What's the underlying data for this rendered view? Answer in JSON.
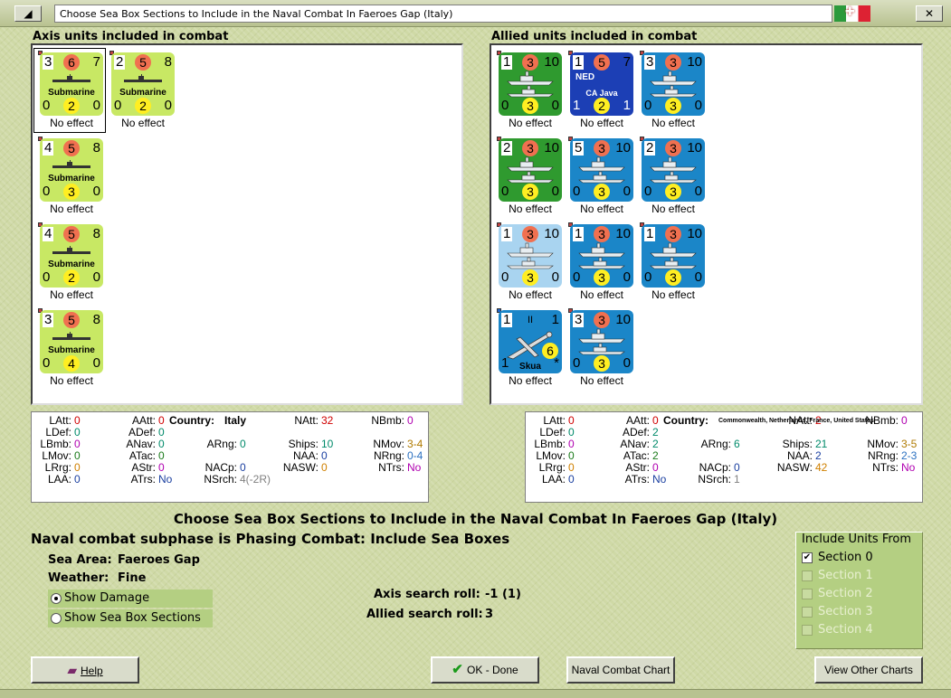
{
  "window": {
    "title": "Choose Sea Box Sections to Include in the Naval Combat In Faeroes Gap (Italy)",
    "close_glyph": "✕",
    "flag_glyph": "✚"
  },
  "axis": {
    "header": "Axis units included in combat",
    "units": [
      {
        "top": "3",
        "mid": "6",
        "right": "7",
        "name": "Submarine",
        "bl": "0",
        "bm": "2",
        "br": "0",
        "effect": "No effect"
      },
      {
        "top": "2",
        "mid": "5",
        "right": "8",
        "name": "Submarine",
        "bl": "0",
        "bm": "2",
        "br": "0",
        "effect": "No effect"
      },
      {
        "top": "4",
        "mid": "5",
        "right": "8",
        "name": "Submarine",
        "bl": "0",
        "bm": "3",
        "br": "0",
        "effect": "No effect"
      },
      {
        "top": "4",
        "mid": "5",
        "right": "8",
        "name": "Submarine",
        "bl": "0",
        "bm": "2",
        "br": "0",
        "effect": "No effect"
      },
      {
        "top": "3",
        "mid": "5",
        "right": "8",
        "name": "Submarine",
        "bl": "0",
        "bm": "4",
        "br": "0",
        "effect": "No effect"
      }
    ]
  },
  "allied": {
    "header": "Allied units included in combat",
    "units": [
      {
        "top": "1",
        "mid": "3",
        "right": "10",
        "name": "",
        "bl": "0",
        "bm": "3",
        "br": "0",
        "effect": "No effect",
        "color": "#2f9a2f"
      },
      {
        "top": "1",
        "mid": "5",
        "right": "7",
        "name": "CA Java",
        "extra": "NED",
        "bl": "1",
        "bm": "2",
        "br": "1",
        "effect": "No effect",
        "color": "#1c3fb5"
      },
      {
        "top": "3",
        "mid": "3",
        "right": "10",
        "name": "",
        "bl": "0",
        "bm": "3",
        "br": "0",
        "effect": "No effect",
        "color": "#1b86c8"
      },
      {
        "top": "2",
        "mid": "3",
        "right": "10",
        "name": "",
        "bl": "0",
        "bm": "3",
        "br": "0",
        "effect": "No effect",
        "color": "#2f9a2f"
      },
      {
        "top": "5",
        "mid": "3",
        "right": "10",
        "name": "",
        "bl": "0",
        "bm": "3",
        "br": "0",
        "effect": "No effect",
        "color": "#1b86c8"
      },
      {
        "top": "2",
        "mid": "3",
        "right": "10",
        "name": "",
        "bl": "0",
        "bm": "3",
        "br": "0",
        "effect": "No effect",
        "color": "#1b86c8"
      },
      {
        "top": "1",
        "mid": "3",
        "right": "10",
        "name": "",
        "bl": "0",
        "bm": "3",
        "br": "0",
        "effect": "No effect",
        "color": "#a9d4f0"
      },
      {
        "top": "1",
        "mid": "3",
        "right": "10",
        "name": "",
        "bl": "0",
        "bm": "3",
        "br": "0",
        "effect": "No effect",
        "color": "#1b86c8"
      },
      {
        "top": "1",
        "mid": "3",
        "right": "10",
        "name": "",
        "bl": "0",
        "bm": "3",
        "br": "0",
        "effect": "No effect",
        "color": "#1b86c8"
      },
      {
        "top": "1",
        "mid": "II",
        "right": "1",
        "name": "Skua",
        "bl": "1",
        "bm": "6",
        "br": "*",
        "effect": "No effect",
        "color": "#1b86c8",
        "air": true
      },
      {
        "top": "3",
        "mid": "3",
        "right": "10",
        "name": "",
        "bl": "0",
        "bm": "3",
        "br": "0",
        "effect": "No effect",
        "color": "#1b86c8"
      }
    ]
  },
  "axis_stats": {
    "country_label": "Country:",
    "country": "Italy",
    "rows": [
      [
        "LAtt:",
        "0",
        "AAtt:",
        "0",
        "",
        "",
        "NAtt:",
        "32",
        "NBmb:",
        "0"
      ],
      [
        "LDef:",
        "0",
        "ADef:",
        "0",
        "",
        "",
        "",
        "",
        "",
        ""
      ],
      [
        "LBmb:",
        "0",
        "ANav:",
        "0",
        "ARng:",
        "0",
        "Ships:",
        "10",
        "NMov:",
        "3-4"
      ],
      [
        "LMov:",
        "0",
        "ATac:",
        "0",
        "",
        "",
        "NAA:",
        "0",
        "NRng:",
        "0-4"
      ],
      [
        "LRrg:",
        "0",
        "AStr:",
        "0",
        "NACp:",
        "0",
        "NASW:",
        "0",
        "NTrs:",
        "No"
      ],
      [
        "LAA:",
        "0",
        "ATrs:",
        "No",
        "NSrch:",
        "4(-2R)",
        "",
        "",
        "",
        ""
      ]
    ]
  },
  "allied_stats": {
    "country_label": "Country:",
    "country": "Commonwealth, Netherlands, France, United States",
    "rows": [
      [
        "LAtt:",
        "0",
        "AAtt:",
        "0",
        "",
        "",
        "NAtt:",
        "2",
        "NBmb:",
        "0"
      ],
      [
        "LDef:",
        "0",
        "ADef:",
        "2",
        "",
        "",
        "",
        "",
        "",
        ""
      ],
      [
        "LBmb:",
        "0",
        "ANav:",
        "2",
        "ARng:",
        "6",
        "Ships:",
        "21",
        "NMov:",
        "3-5"
      ],
      [
        "LMov:",
        "0",
        "ATac:",
        "2",
        "",
        "",
        "NAA:",
        "2",
        "NRng:",
        "2-3"
      ],
      [
        "LRrg:",
        "0",
        "AStr:",
        "0",
        "NACp:",
        "0",
        "NASW:",
        "42",
        "NTrs:",
        "No"
      ],
      [
        "LAA:",
        "0",
        "ATrs:",
        "No",
        "NSrch:",
        "1",
        "",
        "",
        "",
        ""
      ]
    ]
  },
  "main": {
    "heading": "Choose Sea Box Sections to Include in the Naval Combat In Faeroes Gap (Italy)",
    "subphase": "Naval combat subphase is Phasing Combat: Include Sea Boxes",
    "sea_area_label": "Sea Area:",
    "sea_area": "Faeroes Gap",
    "weather_label": "Weather:",
    "weather": "Fine",
    "show_damage": "Show Damage",
    "show_sections": "Show Sea Box Sections",
    "axis_roll_label": "Axis search roll:",
    "axis_roll": "-1 (1)",
    "allied_roll_label": "Allied search roll:",
    "allied_roll": "3"
  },
  "include": {
    "title": "Include Units From",
    "sections": [
      "Section 0",
      "Section 1",
      "Section 2",
      "Section 3",
      "Section 4"
    ]
  },
  "buttons": {
    "help": "Help",
    "ok": "OK - Done",
    "chart": "Naval Combat Chart",
    "other": "View Other Charts"
  },
  "colors": {
    "sub": "#c8e864",
    "attack": "#f07050",
    "defense": "#ffee22"
  }
}
